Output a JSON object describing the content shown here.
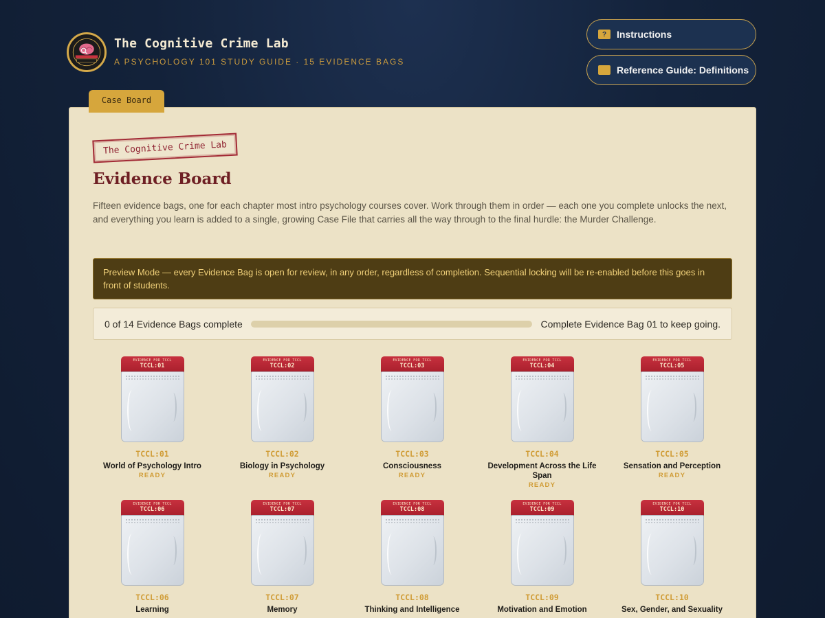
{
  "header": {
    "title": "The Cognitive Crime Lab",
    "subtitle": "A PSYCHOLOGY 101 STUDY GUIDE · 15 EVIDENCE BAGS",
    "logo_icon": "cognitive-crime-lab-badge",
    "logo_text": "COGNITIVE CRIME LAB",
    "instructions_label": "Instructions",
    "instructions_icon": "question-icon",
    "reference_label": "Reference Guide: Definitions",
    "reference_icon": "book-icon"
  },
  "tabs": [
    {
      "label": "Case Board"
    }
  ],
  "board": {
    "stamp": "The Cognitive Crime Lab",
    "title": "Evidence Board",
    "intro": "Fifteen evidence bags, one for each chapter most intro psychology courses cover. Work through them in order — each one you complete unlocks the next, and everything you learn is added to a single, growing Case File that carries all the way through to the final hurdle: the Murder Challenge.",
    "preview_notice": "Preview Mode — every Evidence Bag is open for review, in any order, regardless of completion. Sequential locking will be re-enabled before this goes in front of students.",
    "progress_text": "0 of 14 Evidence Bags complete",
    "progress_fraction": 0,
    "progress_hint": "Complete Evidence Bag 01 to keep going."
  },
  "bag_header_text": "EVIDENCE FOR TCCL",
  "colors": {
    "accent_gold": "#d6a63c",
    "bag_red": "#b52533",
    "board_title": "#6e1f24",
    "background": "#13223a",
    "panel": "#ece2c6"
  },
  "bags": [
    {
      "code": "TCCL:01",
      "title": "World of Psychology Intro",
      "status": "READY"
    },
    {
      "code": "TCCL:02",
      "title": "Biology in Psychology",
      "status": "READY"
    },
    {
      "code": "TCCL:03",
      "title": "Consciousness",
      "status": "READY"
    },
    {
      "code": "TCCL:04",
      "title": "Development Across the Life Span",
      "status": "READY"
    },
    {
      "code": "TCCL:05",
      "title": "Sensation and Perception",
      "status": "READY"
    },
    {
      "code": "TCCL:06",
      "title": "Learning",
      "status": ""
    },
    {
      "code": "TCCL:07",
      "title": "Memory",
      "status": ""
    },
    {
      "code": "TCCL:08",
      "title": "Thinking and Intelligence",
      "status": ""
    },
    {
      "code": "TCCL:09",
      "title": "Motivation and Emotion",
      "status": ""
    },
    {
      "code": "TCCL:10",
      "title": "Sex, Gender, and Sexuality",
      "status": ""
    }
  ]
}
